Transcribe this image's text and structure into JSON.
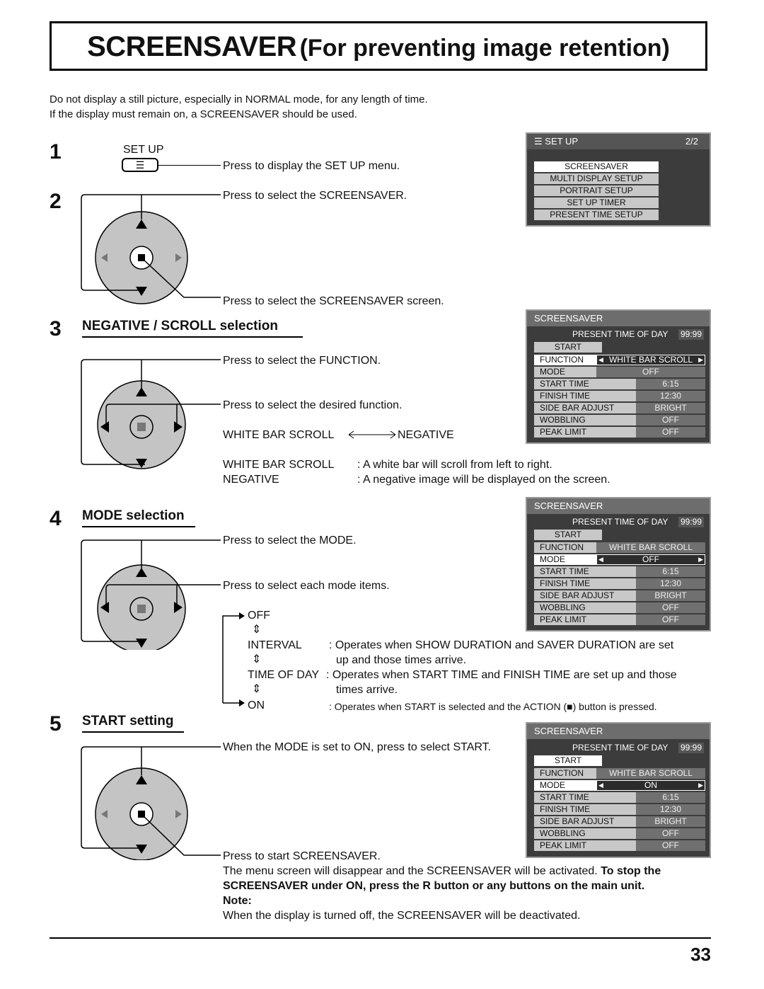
{
  "title": {
    "main": "SCREENSAVER",
    "sub": "(For preventing image retention)"
  },
  "intro": [
    "Do not display a still picture, especially in NORMAL mode, for any length of time.",
    "If the display must remain on, a SCREENSAVER should be used."
  ],
  "steps": {
    "s1": {
      "num": "1",
      "button_label": "SET UP",
      "text": "Press to display the SET UP menu."
    },
    "s2": {
      "num": "2",
      "text_select": "Press to select the SCREENSAVER.",
      "text_enter": "Press to select the SCREENSAVER screen."
    },
    "s3": {
      "num": "3",
      "heading": "NEGATIVE / SCROLL selection",
      "text_function": "Press to select the FUNCTION.",
      "text_desired": "Press to select the desired function.",
      "toggle_left": "WHITE BAR SCROLL",
      "toggle_right": "NEGATIVE",
      "defs": [
        {
          "term": "WHITE BAR SCROLL",
          "desc": ": A white bar will scroll from left to right."
        },
        {
          "term": "NEGATIVE",
          "desc": ": A negative image will be displayed on the screen."
        }
      ]
    },
    "s4": {
      "num": "4",
      "heading": "MODE selection",
      "text_mode": "Press to select the MODE.",
      "text_each": "Press to select each mode items.",
      "modes": [
        {
          "term": "OFF",
          "desc": ""
        },
        {
          "term": "INTERVAL",
          "desc": ": Operates when SHOW DURATION and SAVER DURATION are set",
          "desc2": "up and those times arrive."
        },
        {
          "term": "TIME OF DAY",
          "desc": ": Operates when START TIME and FINISH TIME are set up and those",
          "desc2": "times arrive."
        },
        {
          "term": "ON",
          "desc": ": Operates when START is selected and the ACTION (■) button is pressed."
        }
      ]
    },
    "s5": {
      "num": "5",
      "heading": "START setting",
      "text_select": "When the MODE is set to ON, press to select START.",
      "text_start": "Press to start SCREENSAVER.",
      "text_activated": "The menu screen will disappear and the SCREENSAVER will be activated.",
      "text_stop_1": "To stop the",
      "text_stop_2": "SCREENSAVER under ON, press the R button or any buttons on the main unit.",
      "note_label": "Note:",
      "note_text": "When the display is turned off, the SCREENSAVER will be deactivated."
    }
  },
  "setup_menu": {
    "title": "SET UP",
    "page": "2/2",
    "items": [
      "SCREENSAVER",
      "MULTI DISPLAY SETUP",
      "PORTRAIT SETUP",
      "SET UP TIMER",
      "PRESENT TIME SETUP"
    ],
    "selected_index": 0
  },
  "screensaver_panels": [
    {
      "title": "SCREENSAVER",
      "present_label": "PRESENT  TIME OF DAY",
      "present_value": "99:99",
      "start": "START",
      "function_label": "FUNCTION",
      "function_value": "WHITE BAR SCROLL",
      "mode_label": "MODE",
      "mode_value": "OFF",
      "rows": [
        {
          "label": "START TIME",
          "value": "6:15"
        },
        {
          "label": "FINISH TIME",
          "value": "12:30"
        },
        {
          "label": "SIDE BAR ADJUST",
          "value": "BRIGHT"
        },
        {
          "label": "WOBBLING",
          "value": "OFF"
        },
        {
          "label": "PEAK LIMIT",
          "value": "OFF"
        }
      ],
      "selected": "function"
    },
    {
      "title": "SCREENSAVER",
      "present_label": "PRESENT  TIME OF DAY",
      "present_value": "99:99",
      "start": "START",
      "function_label": "FUNCTION",
      "function_value": "WHITE BAR SCROLL",
      "mode_label": "MODE",
      "mode_value": "OFF",
      "rows": [
        {
          "label": "START TIME",
          "value": "6:15"
        },
        {
          "label": "FINISH TIME",
          "value": "12:30"
        },
        {
          "label": "SIDE BAR ADJUST",
          "value": "BRIGHT"
        },
        {
          "label": "WOBBLING",
          "value": "OFF"
        },
        {
          "label": "PEAK LIMIT",
          "value": "OFF"
        }
      ],
      "selected": "mode"
    },
    {
      "title": "SCREENSAVER",
      "present_label": "PRESENT  TIME OF DAY",
      "present_value": "99:99",
      "start": "START",
      "function_label": "FUNCTION",
      "function_value": "WHITE BAR SCROLL",
      "mode_label": "MODE",
      "mode_value": "ON",
      "rows": [
        {
          "label": "START TIME",
          "value": "6:15"
        },
        {
          "label": "FINISH TIME",
          "value": "12:30"
        },
        {
          "label": "SIDE BAR ADJUST",
          "value": "BRIGHT"
        },
        {
          "label": "WOBBLING",
          "value": "OFF"
        },
        {
          "label": "PEAK LIMIT",
          "value": "OFF"
        }
      ],
      "selected": "mode_start"
    }
  ],
  "page_number": "33"
}
